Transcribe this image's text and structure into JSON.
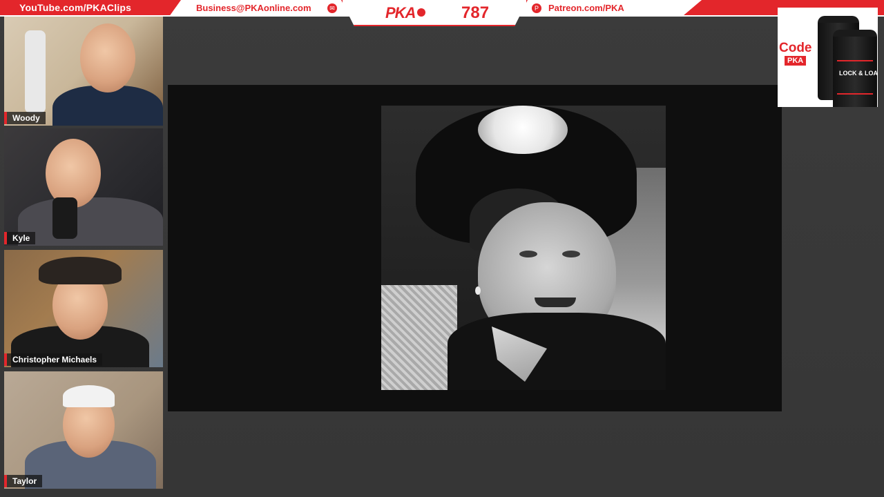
{
  "banner": {
    "youtube": "YouTube.com/PKAClips",
    "business": "Business@PKAonline.com",
    "logo": "PKA",
    "episode": "787",
    "patreon": "Patreon.com/PKA"
  },
  "participants": [
    {
      "name": "Woody"
    },
    {
      "name": "Kyle"
    },
    {
      "name": "Christopher Michaels"
    },
    {
      "name": "Taylor"
    }
  ],
  "sponsor": {
    "code_label": "Code",
    "code_value": "PKA",
    "product": "LOCK & LOAD"
  },
  "colors": {
    "accent": "#e3262b",
    "background": "#3a3a3a",
    "video_bg": "#0f0f0f"
  },
  "icons": {
    "business": "envelope-icon",
    "patreon": "patreon-icon"
  }
}
